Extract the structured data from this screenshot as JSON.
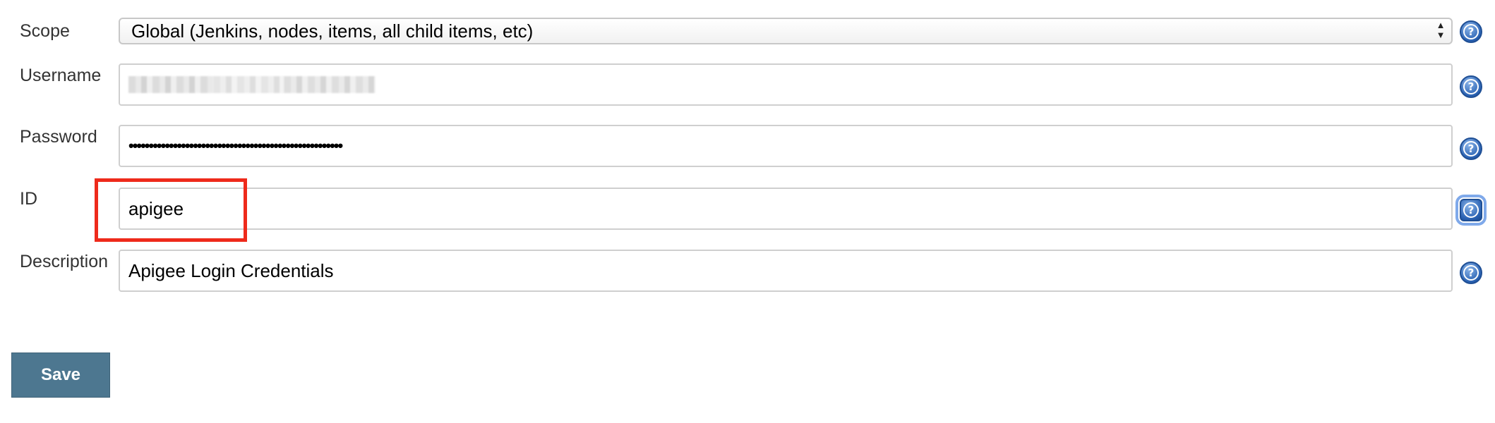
{
  "form": {
    "scope": {
      "label": "Scope",
      "selected": "Global (Jenkins, nodes, items, all child items, etc)",
      "arrows": "▲▼"
    },
    "username": {
      "label": "Username"
    },
    "password": {
      "label": "Password",
      "masked_value": "•••••••••••••••••••••••••••••••••••••••••••••••••••••"
    },
    "id": {
      "label": "ID",
      "value": "apigee"
    },
    "description": {
      "label": "Description",
      "value": "Apigee Login Credentials"
    },
    "help_glyph": "?"
  },
  "actions": {
    "save_label": "Save"
  },
  "colors": {
    "save_button_bg": "#4d7790",
    "highlight_border": "#ee2a1b",
    "help_icon": "#2a62b3"
  }
}
